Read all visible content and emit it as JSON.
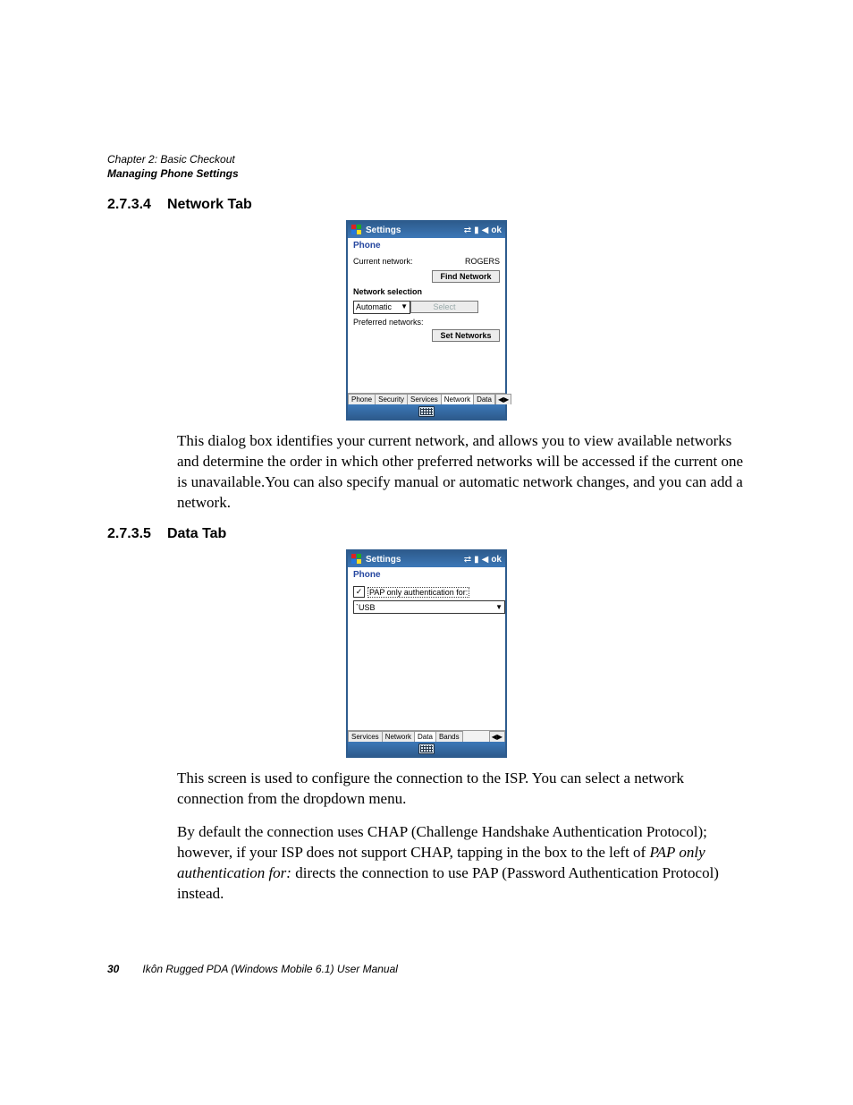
{
  "header": {
    "line1": "Chapter 2: Basic Checkout",
    "line2": "Managing Phone Settings"
  },
  "section_234": {
    "number": "2.7.3.4",
    "title": "Network Tab",
    "paragraph": "This dialog box identifies your current network, and allows you to view available networks and determine the order in which other preferred networks will be accessed if the current one is unavailable.You can also specify manual or automatic network changes, and you can add a network."
  },
  "section_235": {
    "number": "2.7.3.5",
    "title": "Data Tab",
    "p1": "This screen is used to configure the connection to the ISP. You can select a network connection from the dropdown menu.",
    "p2_a": "By default the connection uses CHAP (Challenge Handshake Authentication Protocol); however, if your ISP does not support CHAP, tapping in the box to the left of ",
    "p2_i": "PAP only authentication for:",
    "p2_b": " directs the connection to use PAP (Password Authentication Protocol) instead."
  },
  "shot1": {
    "title": "Settings",
    "sub": "Phone",
    "curlabel": "Current network:",
    "curval": "ROGERS",
    "btn_find": "Find Network",
    "selhead": "Network selection",
    "selval": "Automatic",
    "btn_select": "Select",
    "preflabel": "Preferred networks:",
    "btn_set": "Set Networks",
    "tabs": [
      "Phone",
      "Security",
      "Services",
      "Network",
      "Data"
    ],
    "ok": "ok"
  },
  "shot2": {
    "title": "Settings",
    "sub": "Phone",
    "checklabel": "PAP only authentication for:",
    "ddval": "`USB",
    "tabs": [
      "Services",
      "Network",
      "Data",
      "Bands"
    ],
    "ok": "ok"
  },
  "footer": {
    "page": "30",
    "text": "Ikôn Rugged PDA (Windows Mobile 6.1) User Manual"
  }
}
